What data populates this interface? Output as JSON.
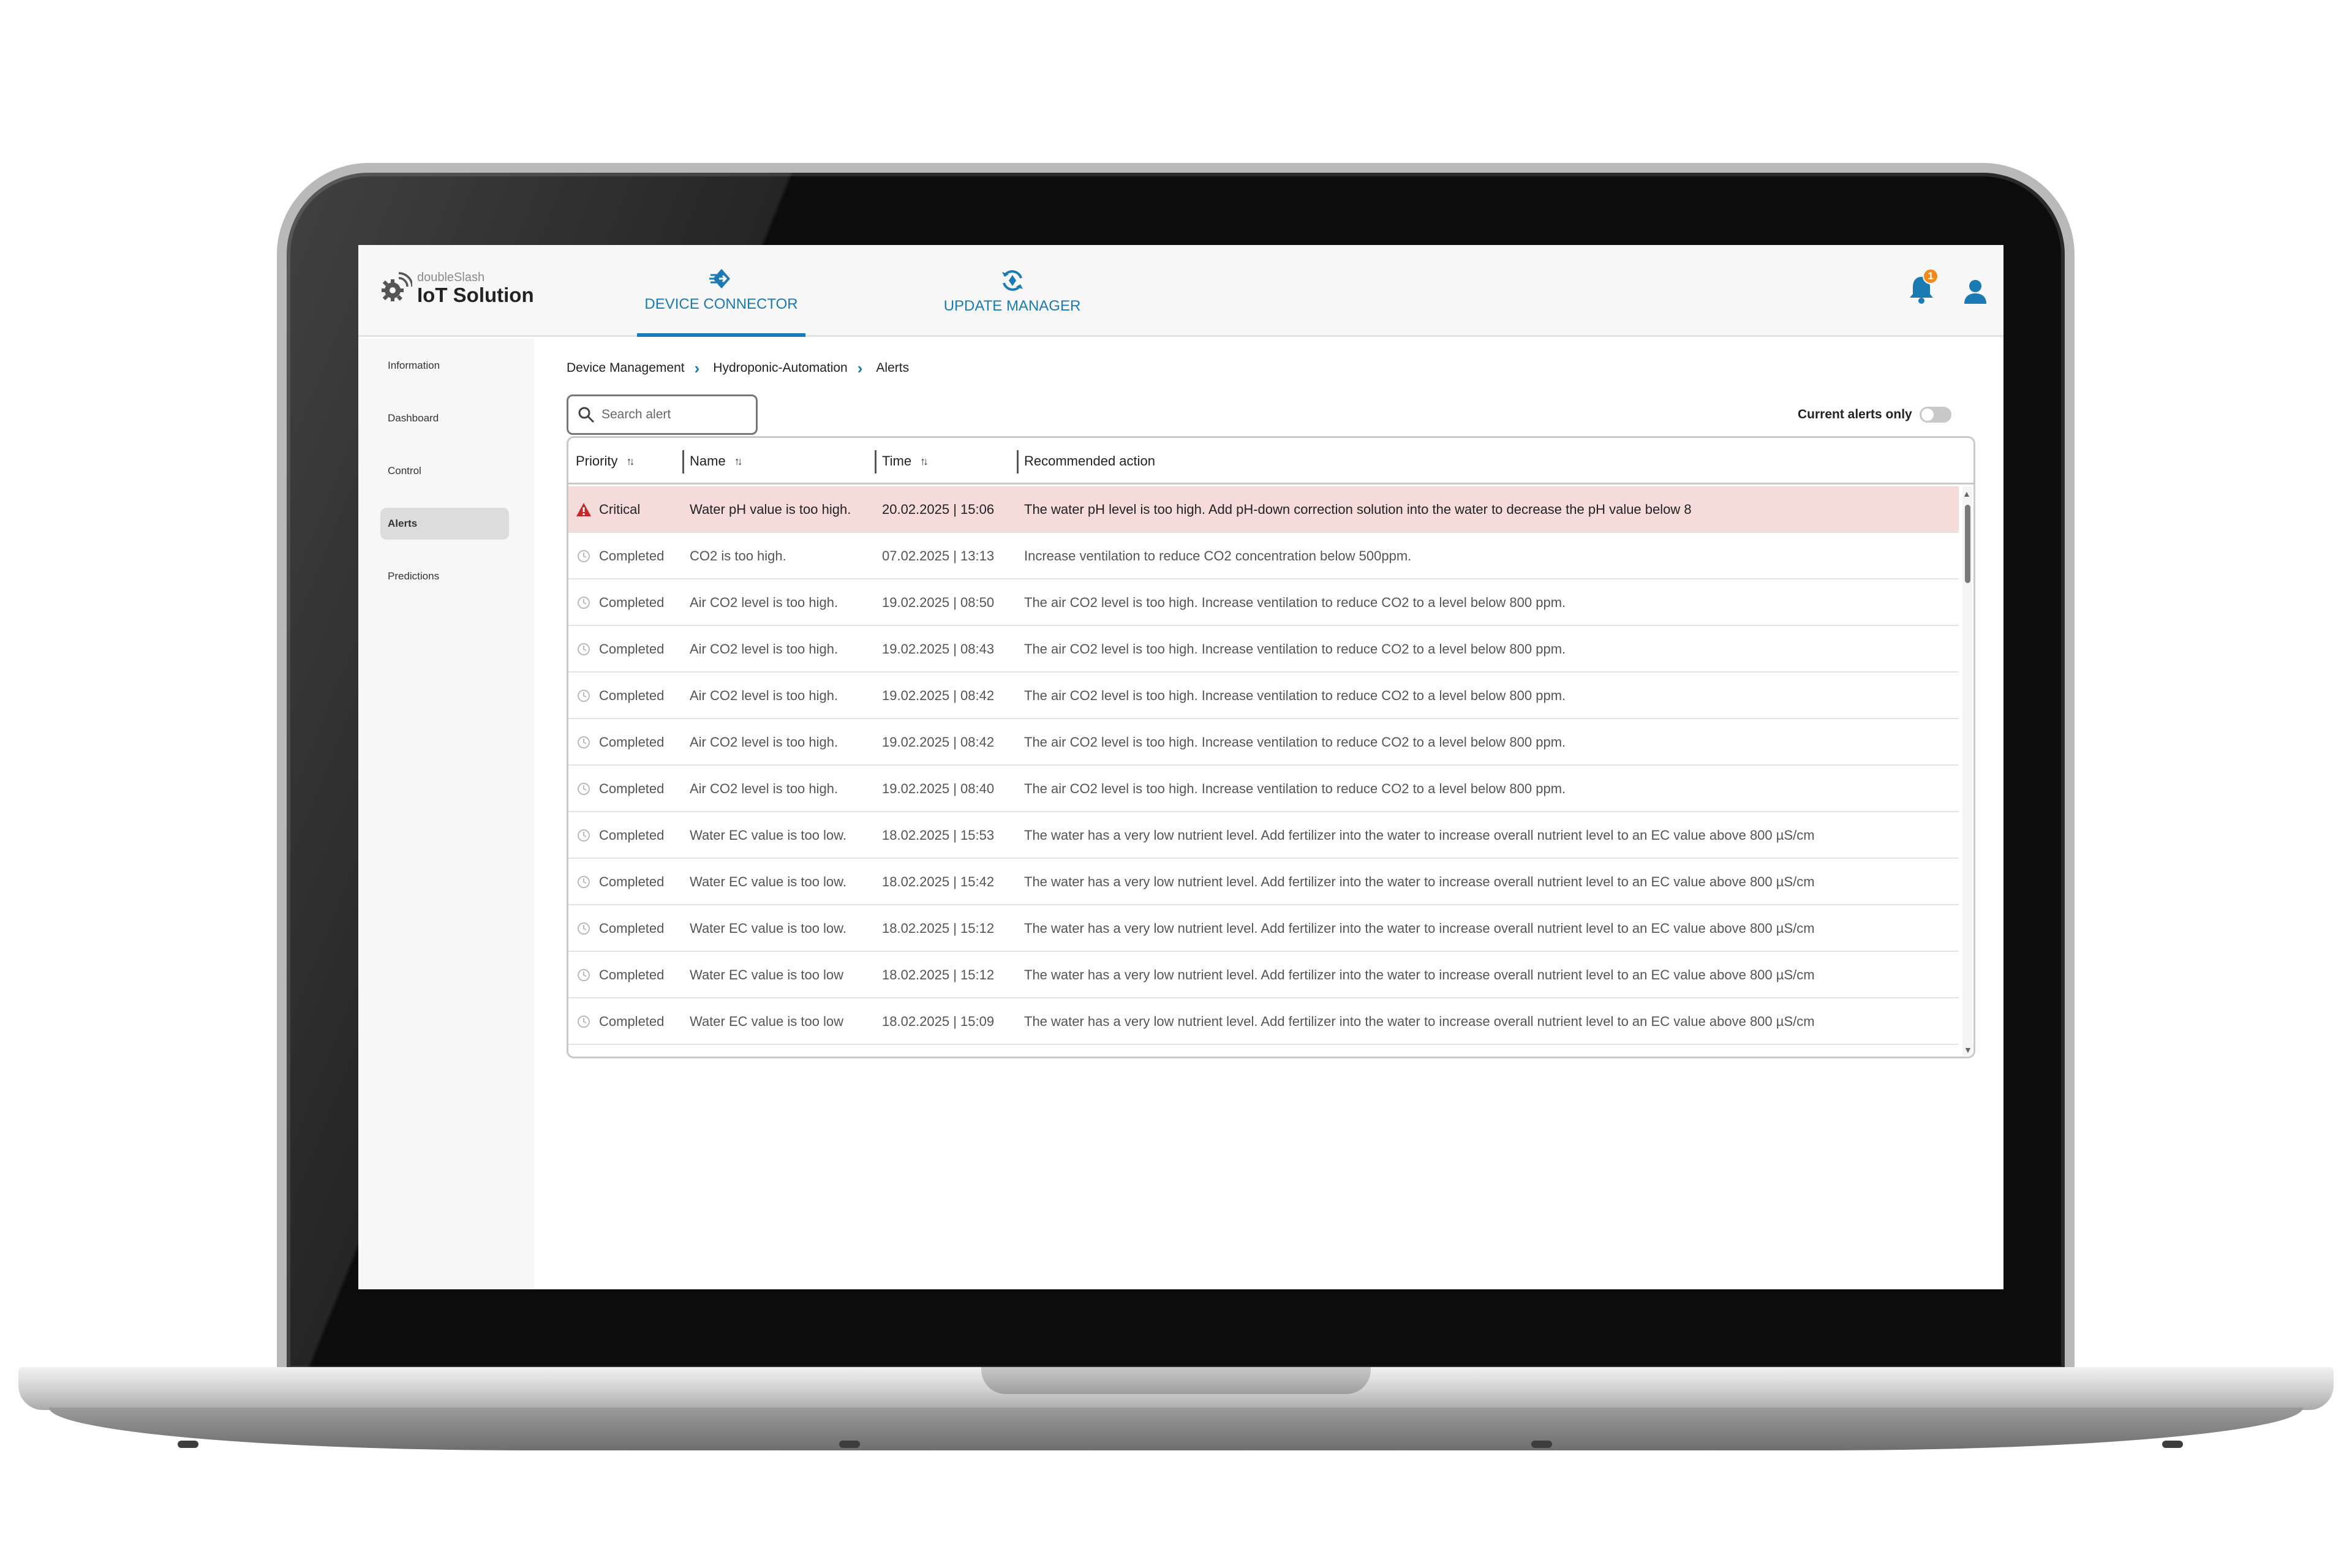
{
  "app": {
    "brand_small": "doubleSlash",
    "brand_big": "IoT Solution"
  },
  "top_nav": {
    "device_connector": "DEVICE CONNECTOR",
    "update_manager": "UPDATE MANAGER",
    "notification_count": "1"
  },
  "sidebar": {
    "items": [
      {
        "label": "Information"
      },
      {
        "label": "Dashboard"
      },
      {
        "label": "Control"
      },
      {
        "label": "Alerts"
      },
      {
        "label": "Predictions"
      }
    ]
  },
  "breadcrumb": {
    "items": [
      "Device Management",
      "Hydroponic-Automation",
      "Alerts"
    ]
  },
  "search": {
    "placeholder": "Search alert"
  },
  "filter": {
    "current_only_label": "Current alerts only"
  },
  "table": {
    "headers": {
      "priority": "Priority",
      "name": "Name",
      "time": "Time",
      "action": "Recommended action"
    },
    "rows": [
      {
        "priority": "Critical",
        "name": "Water pH value is too high.",
        "time": "20.02.2025 | 15:06",
        "action": "The water pH level is too high. Add pH-down correction solution into the water to decrease the pH value below 8"
      },
      {
        "priority": "Completed",
        "name": "CO2 is too high.",
        "time": "07.02.2025 | 13:13",
        "action": "Increase ventilation to reduce CO2 concentration below 500ppm."
      },
      {
        "priority": "Completed",
        "name": "Air CO2 level is too high.",
        "time": "19.02.2025 | 08:50",
        "action": "The air CO2 level is too high. Increase ventilation to reduce CO2 to a level below 800 ppm."
      },
      {
        "priority": "Completed",
        "name": "Air CO2 level is too high.",
        "time": "19.02.2025 | 08:43",
        "action": "The air CO2 level is too high. Increase ventilation to reduce CO2 to a level below 800 ppm."
      },
      {
        "priority": "Completed",
        "name": "Air CO2 level is too high.",
        "time": "19.02.2025 | 08:42",
        "action": "The air CO2 level is too high. Increase ventilation to reduce CO2 to a level below 800 ppm."
      },
      {
        "priority": "Completed",
        "name": "Air CO2 level is too high.",
        "time": "19.02.2025 | 08:42",
        "action": "The air CO2 level is too high. Increase ventilation to reduce CO2 to a level below 800 ppm."
      },
      {
        "priority": "Completed",
        "name": "Air CO2 level is too high.",
        "time": "19.02.2025 | 08:40",
        "action": "The air CO2 level is too high. Increase ventilation to reduce CO2 to a level below 800 ppm."
      },
      {
        "priority": "Completed",
        "name": "Water EC value is too low.",
        "time": "18.02.2025 | 15:53",
        "action": "The water has a very low nutrient level. Add fertilizer into the water to increase overall nutrient level to an EC value above 800 µS/cm"
      },
      {
        "priority": "Completed",
        "name": "Water EC value is too low.",
        "time": "18.02.2025 | 15:42",
        "action": "The water has a very low nutrient level. Add fertilizer into the water to increase overall nutrient level to an EC value above 800 µS/cm"
      },
      {
        "priority": "Completed",
        "name": "Water EC value is too low.",
        "time": "18.02.2025 | 15:12",
        "action": "The water has a very low nutrient level. Add fertilizer into the water to increase overall nutrient level to an EC value above 800 µS/cm"
      },
      {
        "priority": "Completed",
        "name": "Water EC value is too low",
        "time": "18.02.2025 | 15:12",
        "action": "The water has a very low nutrient level. Add fertilizer into the water to increase overall nutrient level to an EC value above 800 µS/cm"
      },
      {
        "priority": "Completed",
        "name": "Water EC value is too low",
        "time": "18.02.2025 | 15:09",
        "action": "The water has a very low nutrient level. Add fertilizer into the water to increase overall nutrient level to an EC value above 800 µS/cm"
      }
    ]
  },
  "colors": {
    "accent": "#1a7ab3",
    "critical_row": "#f6dbdb",
    "critical_icon": "#c62828",
    "badge": "#f08a1c"
  },
  "icons": {
    "logo": "gear-wifi-icon",
    "device_connector": "device-connector-icon",
    "update_manager": "update-cycle-icon",
    "notifications": "bell-icon",
    "user": "user-icon",
    "search": "search-icon",
    "critical": "warning-triangle-icon",
    "completed": "clock-icon",
    "sort": "sort-icon"
  }
}
